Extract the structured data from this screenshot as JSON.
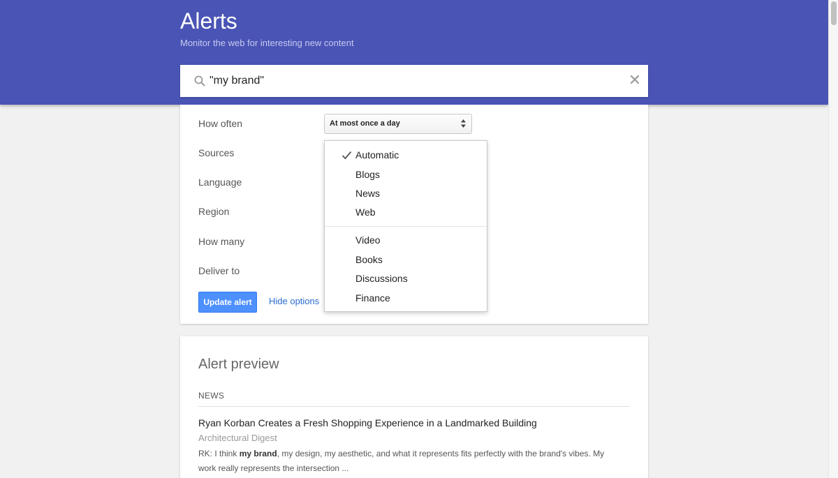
{
  "header": {
    "title": "Alerts",
    "subtitle": "Monitor the web for interesting new content",
    "bg_color": "#4a54b5"
  },
  "search": {
    "value": "\"my brand\"",
    "search_icon": "search-icon",
    "clear_icon": "close-icon",
    "clear_glyph": "✕"
  },
  "options": {
    "labels": [
      "How often",
      "Sources",
      "Language",
      "Region",
      "How many",
      "Deliver to"
    ],
    "how_often_value": "At most once a day",
    "update_button": "Update alert",
    "hide_link": "Hide options",
    "button_color": "#4d90fe",
    "link_color": "#2a6ccd"
  },
  "sources_dropdown": {
    "selected": "Automatic",
    "group1": [
      "Automatic",
      "Blogs",
      "News",
      "Web"
    ],
    "group2": [
      "Video",
      "Books",
      "Discussions",
      "Finance"
    ]
  },
  "preview": {
    "title": "Alert preview",
    "section": "NEWS",
    "article": {
      "title": "Ryan Korban Creates a Fresh Shopping Experience in a Landmarked Building",
      "source": "Architectural Digest",
      "snippet_prefix": "RK: I think ",
      "snippet_bold": "my brand",
      "snippet_line1_rest": ", my design, my aesthetic, and what it represents fits perfectly with the brand's vibes. My",
      "snippet_line2": "work really represents the intersection ..."
    }
  }
}
